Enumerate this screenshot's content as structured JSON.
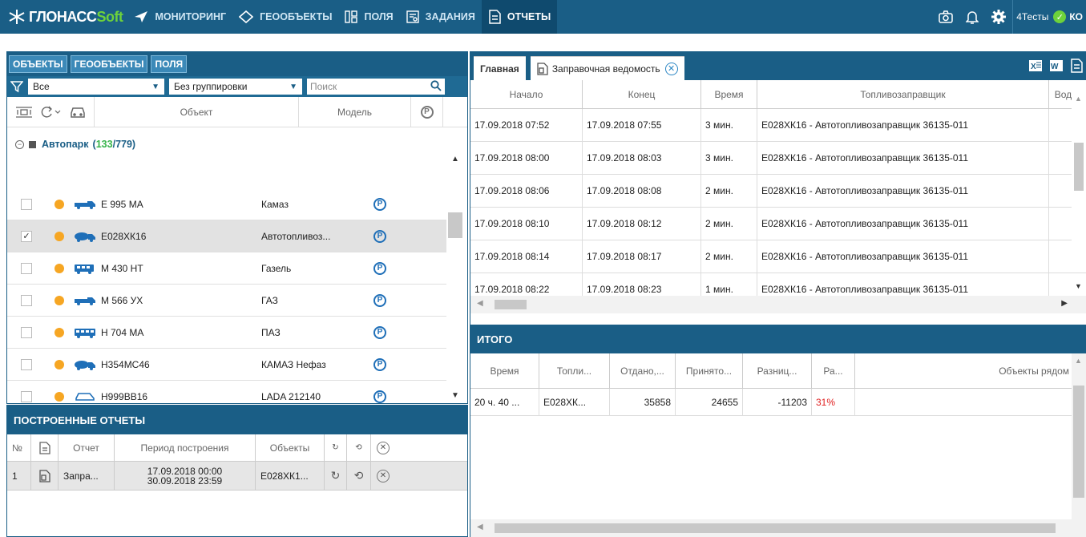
{
  "app": {
    "logo_prefix": "ГЛОНАСС",
    "logo_suffix": "Soft",
    "nav": [
      {
        "label": "МОНИТОРИНГ"
      },
      {
        "label": "ГЕООБЪЕКТЫ"
      },
      {
        "label": "ПОЛЯ"
      },
      {
        "label": "ЗАДАНИЯ"
      },
      {
        "label": "ОТЧЕТЫ"
      }
    ],
    "user_label": "4Тесты",
    "user_short": "КО"
  },
  "left_panel": {
    "tabs": [
      "ОБЪЕКТЫ",
      "ГЕООБЪЕКТЫ",
      "ПОЛЯ"
    ],
    "filter_value": "Все",
    "grouping_value": "Без группировки",
    "search_placeholder": "Поиск",
    "col_object": "Объект",
    "col_model": "Модель",
    "group": {
      "name": "Автопарк",
      "online": "133",
      "total": "779"
    },
    "vehicles": [
      {
        "number": "Е 995 МА",
        "model": "Камаз",
        "checked": false,
        "selected": false
      },
      {
        "number": "Е028ХК16",
        "model": "Автотопливоз...",
        "checked": true,
        "selected": true
      },
      {
        "number": "М 430 НТ",
        "model": "Газель",
        "checked": false,
        "selected": false
      },
      {
        "number": "М 566 УХ",
        "model": "ГАЗ",
        "checked": false,
        "selected": false
      },
      {
        "number": "Н 704 МА",
        "model": "ПАЗ",
        "checked": false,
        "selected": false
      },
      {
        "number": "Н354МС46",
        "model": "КАМАЗ Нефаз",
        "checked": false,
        "selected": false
      },
      {
        "number": "Н999ВВ16",
        "model": "LADA 212140",
        "checked": false,
        "selected": false
      }
    ]
  },
  "reports_panel": {
    "title": "ПОСТРОЕННЫЕ ОТЧЕТЫ",
    "col_num": "№",
    "col_report": "Отчет",
    "col_period": "Период построения",
    "col_objects": "Объекты",
    "rows": [
      {
        "num": "1",
        "report": "Запра...",
        "period_from": "17.09.2018 00:00",
        "period_to": "30.09.2018 23:59",
        "objects": "Е028ХК1..."
      }
    ]
  },
  "right_panel": {
    "tab_main": "Главная",
    "tab_report": "Заправочная ведомость",
    "columns": [
      "Начало",
      "Конец",
      "Время",
      "Топливозаправщик",
      "Водит"
    ],
    "rows": [
      {
        "start": "17.09.2018 07:52",
        "end": "17.09.2018 07:55",
        "time": "3 мин.",
        "truck": "Е028ХК16 - Автотопливозаправщик 36135-011"
      },
      {
        "start": "17.09.2018 08:00",
        "end": "17.09.2018 08:03",
        "time": "3 мин.",
        "truck": "Е028ХК16 - Автотопливозаправщик 36135-011"
      },
      {
        "start": "17.09.2018 08:06",
        "end": "17.09.2018 08:08",
        "time": "2 мин.",
        "truck": "Е028ХК16 - Автотопливозаправщик 36135-011"
      },
      {
        "start": "17.09.2018 08:10",
        "end": "17.09.2018 08:12",
        "time": "2 мин.",
        "truck": "Е028ХК16 - Автотопливозаправщик 36135-011"
      },
      {
        "start": "17.09.2018 08:14",
        "end": "17.09.2018 08:17",
        "time": "2 мин.",
        "truck": "Е028ХК16 - Автотопливозаправщик 36135-011"
      },
      {
        "start": "17.09.2018 08:22",
        "end": "17.09.2018 08:23",
        "time": "1 мин.",
        "truck": "Е028ХК16 - Автотопливозаправщик 36135-011"
      }
    ],
    "itogo": {
      "title": "ИТОГО",
      "columns": [
        "Время",
        "Топли...",
        "Отдано,...",
        "Принято...",
        "Разниц...",
        "Ра...",
        "Объекты рядом"
      ],
      "row": {
        "time": "20 ч. 40 ...",
        "truck": "Е028ХК...",
        "given": "35858",
        "received": "24655",
        "diff": "-11203",
        "pct": "31%"
      },
      "pct_color": "#e02020"
    }
  },
  "colors": {
    "primary": "#1a5e86",
    "accent_green": "#6dd23b",
    "dot_orange": "#f6a623"
  }
}
